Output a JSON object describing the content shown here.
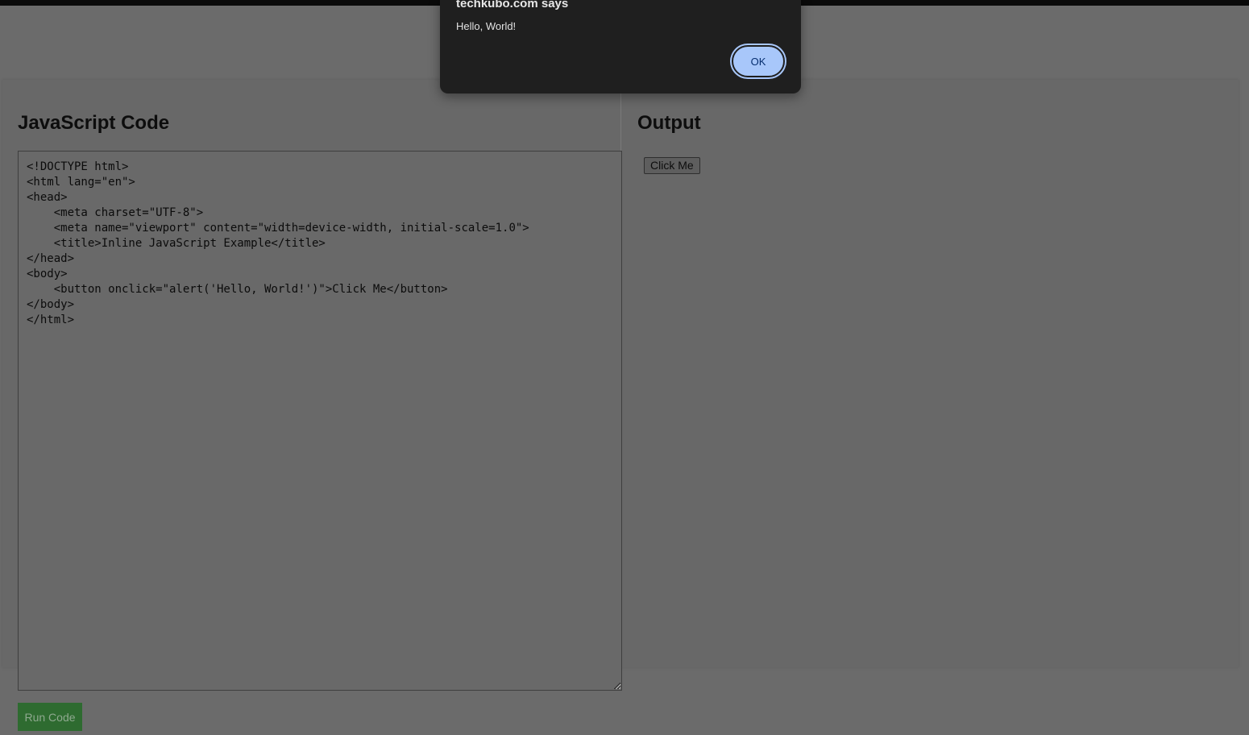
{
  "dialog": {
    "title": "techkubo.com says",
    "message": "Hello, World!",
    "ok_label": "OK"
  },
  "editor": {
    "heading": "JavaScript Code",
    "code": "<!DOCTYPE html>\n<html lang=\"en\">\n<head>\n    <meta charset=\"UTF-8\">\n    <meta name=\"viewport\" content=\"width=device-width, initial-scale=1.0\">\n    <title>Inline JavaScript Example</title>\n</head>\n<body>\n    <button onclick=\"alert('Hello, World!')\">Click Me</button>\n</body>\n</html>",
    "run_label": "Run Code"
  },
  "output": {
    "heading": "Output",
    "button_label": "Click Me"
  },
  "colors": {
    "overlay": "#6b6b6b",
    "dialog_bg": "#1f1f1f",
    "ok_button": "#a8c7fa",
    "run_button": "#2e6b30"
  }
}
